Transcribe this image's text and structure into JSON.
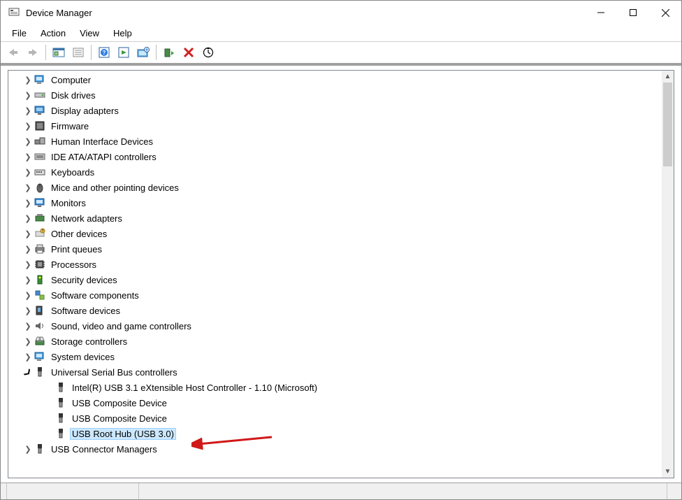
{
  "window": {
    "title": "Device Manager"
  },
  "menu": {
    "file": "File",
    "action": "Action",
    "view": "View",
    "help": "Help"
  },
  "tree": {
    "computer": "Computer",
    "disk_drives": "Disk drives",
    "display_adapters": "Display adapters",
    "firmware": "Firmware",
    "hid": "Human Interface Devices",
    "ide": "IDE ATA/ATAPI controllers",
    "keyboards": "Keyboards",
    "mice": "Mice and other pointing devices",
    "monitors": "Monitors",
    "network": "Network adapters",
    "other": "Other devices",
    "print_queues": "Print queues",
    "processors": "Processors",
    "security": "Security devices",
    "soft_components": "Software components",
    "soft_devices": "Software devices",
    "sound": "Sound, video and game controllers",
    "storage": "Storage controllers",
    "system": "System devices",
    "usb_ctrl": "Universal Serial Bus controllers",
    "usb_children": {
      "intel": "Intel(R) USB 3.1 eXtensible Host Controller - 1.10 (Microsoft)",
      "composite1": "USB Composite Device",
      "composite2": "USB Composite Device",
      "roothub": "USB Root Hub (USB 3.0)"
    },
    "usb_conn_mgr": "USB Connector Managers"
  }
}
